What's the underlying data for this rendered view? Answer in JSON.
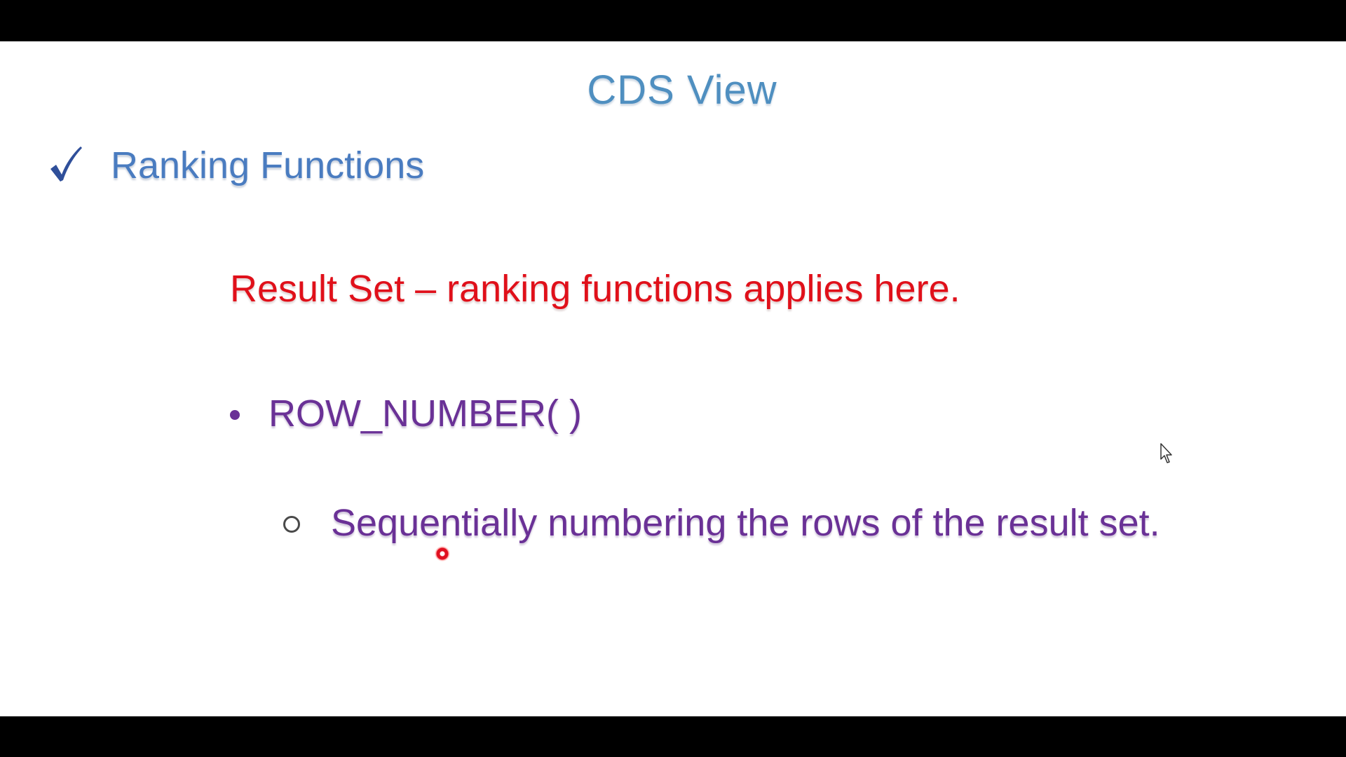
{
  "slide": {
    "title": "CDS View",
    "section": {
      "heading": "Ranking Functions",
      "icon": "check-icon"
    },
    "result_line": "Result Set – ranking functions applies here.",
    "bullet": {
      "text": "ROW_NUMBER( )"
    },
    "sub_bullet": {
      "text": "Sequentially numbering the rows of the result set."
    }
  },
  "colors": {
    "title": "#4f8fc0",
    "heading": "#4a7cc0",
    "result_line": "#e0101a",
    "bullet_text": "#6a3196",
    "background": "#ffffff",
    "letterbox": "#000000"
  }
}
